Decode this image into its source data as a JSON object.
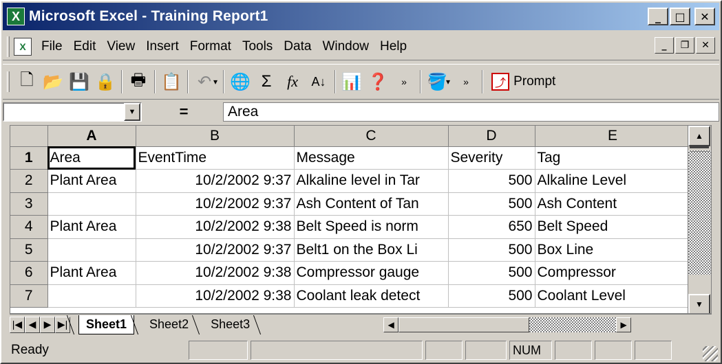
{
  "window": {
    "title": "Microsoft Excel - Training Report1",
    "buttons": {
      "minimize": "_",
      "maximize": "□",
      "close": "✕"
    }
  },
  "menu": {
    "items": [
      {
        "label": "File"
      },
      {
        "label": "Edit"
      },
      {
        "label": "View"
      },
      {
        "label": "Insert"
      },
      {
        "label": "Format"
      },
      {
        "label": "Tools"
      },
      {
        "label": "Data"
      },
      {
        "label": "Window"
      },
      {
        "label": "Help"
      }
    ],
    "doc_buttons": {
      "minimize": "_",
      "restore": "❐",
      "close": "✕"
    }
  },
  "toolbar": {
    "icons": [
      "new-icon",
      "open-icon",
      "save-icon",
      "permission-icon",
      "print-icon",
      "paste-icon",
      "undo-icon",
      "hyperlink-icon",
      "autosum-icon",
      "function-icon",
      "sort-ascending-icon",
      "chart-wizard-icon",
      "help-icon",
      "fill-color-icon"
    ],
    "prompt_label": "Prompt"
  },
  "formula_bar": {
    "name_box": "",
    "equals": "=",
    "value": "Area"
  },
  "sheet": {
    "columns": [
      "A",
      "B",
      "C",
      "D",
      "E"
    ],
    "rows": [
      {
        "num": "1",
        "cells": [
          "Area",
          "EventTime",
          "Message",
          "Severity",
          "Tag"
        ]
      },
      {
        "num": "2",
        "cells": [
          "Plant Area",
          "10/2/2002 9:37",
          "Alkaline level in Tar",
          "500",
          "Alkaline Level"
        ]
      },
      {
        "num": "3",
        "cells": [
          "",
          "10/2/2002 9:37",
          "Ash Content of Tan",
          "500",
          "Ash Content"
        ]
      },
      {
        "num": "4",
        "cells": [
          "Plant Area",
          "10/2/2002 9:38",
          "Belt Speed is norm",
          "650",
          "Belt Speed"
        ]
      },
      {
        "num": "5",
        "cells": [
          "",
          "10/2/2002 9:37",
          "Belt1 on the Box Li",
          "500",
          "Box Line"
        ]
      },
      {
        "num": "6",
        "cells": [
          "Plant Area",
          "10/2/2002 9:38",
          "Compressor gauge",
          "500",
          "Compressor"
        ]
      },
      {
        "num": "7",
        "cells": [
          "",
          "10/2/2002 9:38",
          "Coolant leak detect",
          "500",
          "Coolant Level"
        ]
      }
    ]
  },
  "tabs": [
    {
      "label": "Sheet1",
      "active": true
    },
    {
      "label": "Sheet2",
      "active": false
    },
    {
      "label": "Sheet3",
      "active": false
    }
  ],
  "status": {
    "text": "Ready",
    "num_indicator": "NUM"
  }
}
